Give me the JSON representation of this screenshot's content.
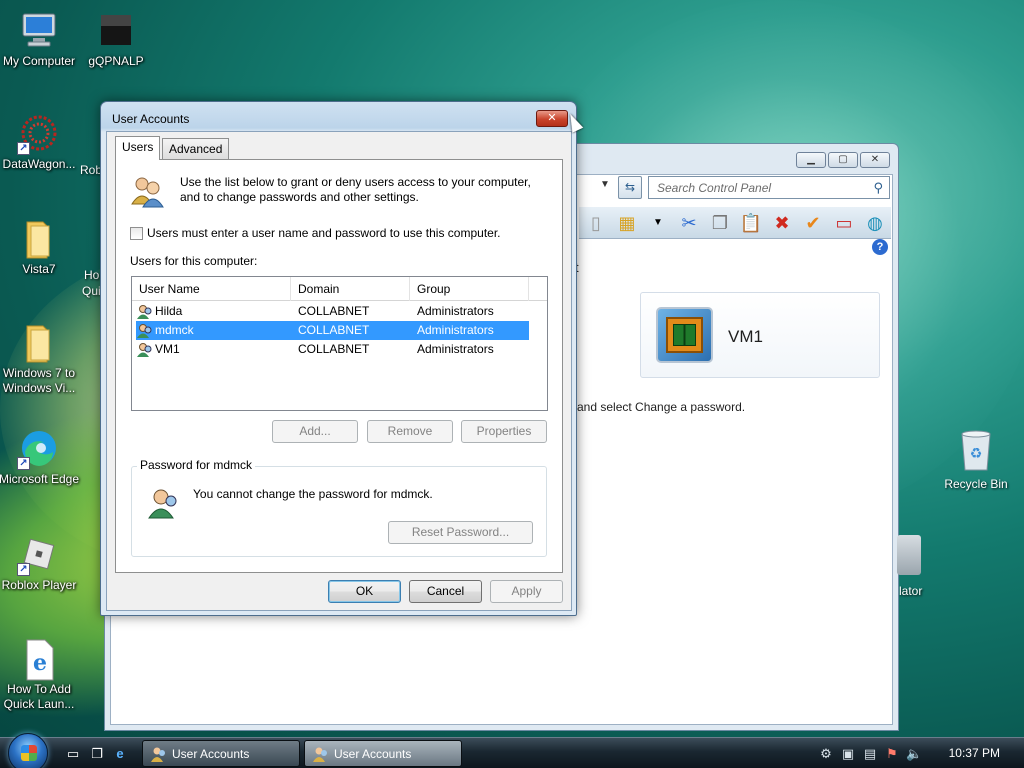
{
  "desktop": {
    "icons_left": [
      {
        "label": "My Computer"
      },
      {
        "label": "gQPNALP"
      },
      {
        "label": "DataWagon..."
      },
      {
        "label": "Rob"
      },
      {
        "label": "Vista7"
      },
      {
        "label": "Ho"
      },
      {
        "label": "Qui"
      },
      {
        "label": "Windows 7 to Windows Vi..."
      },
      {
        "label": "Microsoft Edge"
      },
      {
        "label": "Roblox Player"
      },
      {
        "label": "How To Add Quick Laun..."
      }
    ],
    "recycle_bin": "Recycle Bin",
    "partial_right_label": "lator"
  },
  "control_panel": {
    "search_placeholder": "Search Control Panel",
    "user_tile_name": "VM1",
    "body_text": "and select Change a password.",
    "frag_t": "t"
  },
  "dialog": {
    "title": "User Accounts",
    "tabs": [
      "Users",
      "Advanced"
    ],
    "intro": "Use the list below to grant or deny users access to your computer, and to change passwords and other settings.",
    "checkbox_label": "Users must enter a user name and password to use this computer.",
    "users_label": "Users for this computer:",
    "columns": [
      "User Name",
      "Domain",
      "Group"
    ],
    "rows": [
      {
        "name": "Hilda",
        "domain": "COLLABNET",
        "group": "Administrators"
      },
      {
        "name": "mdmck",
        "domain": "COLLABNET",
        "group": "Administrators",
        "selected": true
      },
      {
        "name": "VM1",
        "domain": "COLLABNET",
        "group": "Administrators"
      }
    ],
    "buttons": {
      "add": "Add...",
      "remove": "Remove",
      "properties": "Properties"
    },
    "password_group": {
      "legend": "Password for mdmck",
      "message": "You cannot change the password for mdmck.",
      "reset": "Reset Password..."
    },
    "footer": {
      "ok": "OK",
      "cancel": "Cancel",
      "apply": "Apply"
    }
  },
  "taskbar": {
    "tasks": [
      "User Accounts",
      "User Accounts"
    ],
    "clock": "10:37 PM"
  },
  "colors": {
    "selection": "#3399ff",
    "taskbar": "#1a2731"
  }
}
